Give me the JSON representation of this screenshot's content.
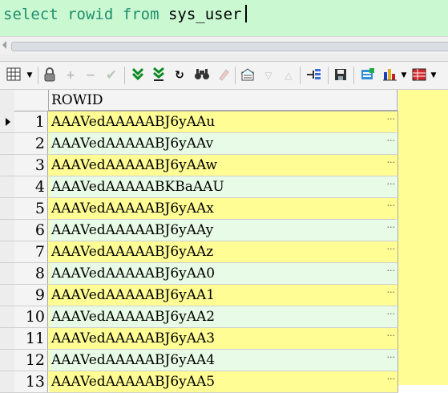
{
  "editor": {
    "sql_keyword1": "select",
    "sql_ident1": "rowid",
    "sql_keyword2": "from",
    "sql_ident2": "sys_user"
  },
  "toolbar": {
    "icons": [
      "grid-icon",
      "lock-icon",
      "add-record-icon",
      "delete-record-icon",
      "post-icon",
      "fetch-next-icon",
      "fetch-all-icon",
      "refresh-icon",
      "find-icon",
      "clear-icon",
      "query-by-example-icon",
      "filter-down-icon",
      "filter-up-icon",
      "tree-icon",
      "save-icon",
      "export-icon",
      "chart-icon",
      "table-menu-icon"
    ]
  },
  "grid": {
    "column_header": "ROWID",
    "rows": [
      {
        "num": "1",
        "rowid": "AAAVedAAAAABJ6yAAu"
      },
      {
        "num": "2",
        "rowid": "AAAVedAAAAABJ6yAAv"
      },
      {
        "num": "3",
        "rowid": "AAAVedAAAAABJ6yAAw"
      },
      {
        "num": "4",
        "rowid": "AAAVedAAAAABKBaAAU"
      },
      {
        "num": "5",
        "rowid": "AAAVedAAAAABJ6yAAx"
      },
      {
        "num": "6",
        "rowid": "AAAVedAAAAABJ6yAAy"
      },
      {
        "num": "7",
        "rowid": "AAAVedAAAAABJ6yAAz"
      },
      {
        "num": "8",
        "rowid": "AAAVedAAAAABJ6yAA0"
      },
      {
        "num": "9",
        "rowid": "AAAVedAAAAABJ6yAA1"
      },
      {
        "num": "10",
        "rowid": "AAAVedAAAAABJ6yAA2"
      },
      {
        "num": "11",
        "rowid": "AAAVedAAAAABJ6yAA3"
      },
      {
        "num": "12",
        "rowid": "AAAVedAAAAABJ6yAA4"
      },
      {
        "num": "13",
        "rowid": "AAAVedAAAAABJ6yAA5"
      }
    ],
    "cell_button": "···"
  },
  "colors": {
    "editor_bg": "#c9f8d1",
    "keyword": "#1f8f6e",
    "row_odd": "#fffd94",
    "row_even": "#e8fbe6"
  }
}
